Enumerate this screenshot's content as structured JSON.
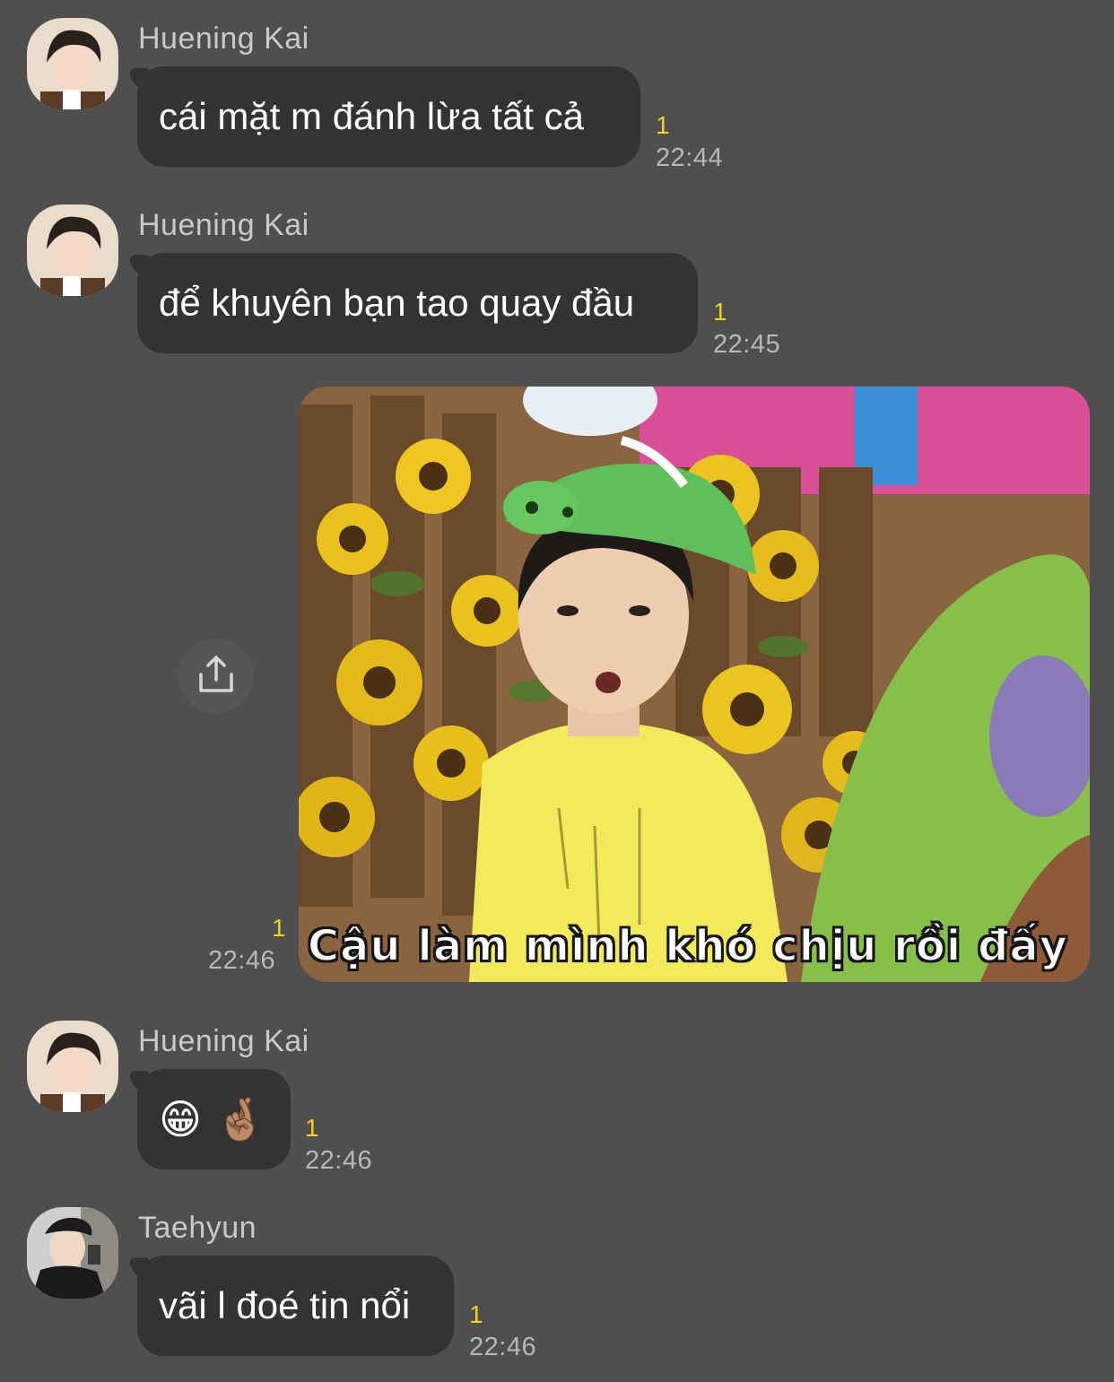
{
  "messages": [
    {
      "sender": "Huening Kai",
      "text": "cái mặt m đánh lừa tất cả",
      "unread": "1",
      "time": "22:44"
    },
    {
      "sender": "Huening Kai",
      "text": "để khuyên bạn tao quay đầu",
      "unread": "1",
      "time": "22:45"
    },
    {
      "image_caption": "Cậu làm mình khó chịu rồi đấy",
      "unread": "1",
      "time": "22:46"
    },
    {
      "sender": "Huening Kai",
      "text": "😁 🤞🏽",
      "unread": "1",
      "time": "22:46"
    },
    {
      "sender": "Taehyun",
      "text": "vãi l đoé tin nổi",
      "unread": "1",
      "time": "22:46"
    }
  ],
  "icons": {
    "share": "share-icon"
  },
  "colors": {
    "background": "#4f4f4f",
    "bubble": "#333333",
    "unread": "#f2d21b"
  }
}
